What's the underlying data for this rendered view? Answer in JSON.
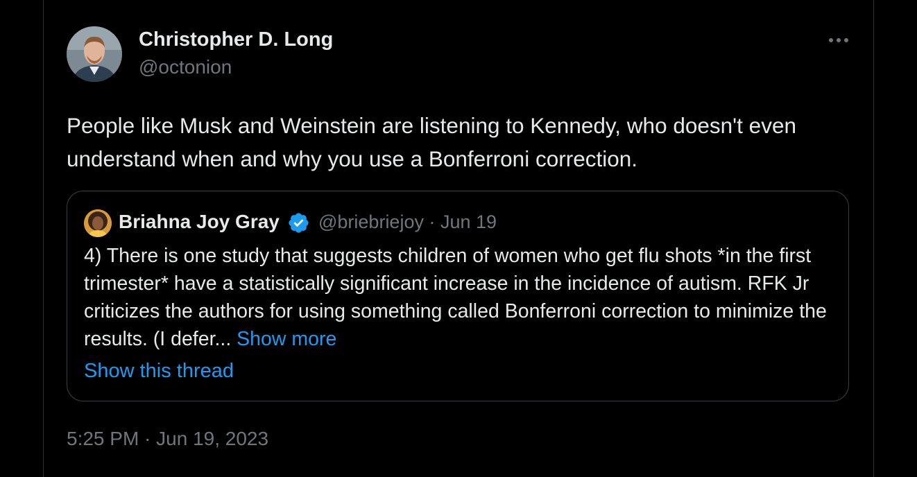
{
  "tweet": {
    "author_name": "Christopher D. Long",
    "author_handle": "@octonion",
    "text": "People like Musk and Weinstein are listening to Kennedy, who doesn't even understand when and why you use a Bonferroni correction.",
    "timestamp": "5:25 PM · Jun 19, 2023",
    "more_icon": "more-horizontal-icon"
  },
  "quote": {
    "author_name": "Briahna Joy Gray",
    "verified_icon": "verified-badge-icon",
    "meta": "@briebriejoy · Jun 19",
    "text": "4) There is one study that suggests children of women who get flu shots *in the first trimester* have a statistically significant increase in the incidence of autism. RFK Jr criticizes the authors for using something called Bonferroni correction to minimize the results. (I defer...",
    "show_more": "Show more",
    "show_thread": "Show this thread"
  },
  "colors": {
    "background": "#000000",
    "text": "#e7e9ea",
    "secondary": "#71767b",
    "link": "#1d9bf0",
    "border": "#2f3336"
  }
}
